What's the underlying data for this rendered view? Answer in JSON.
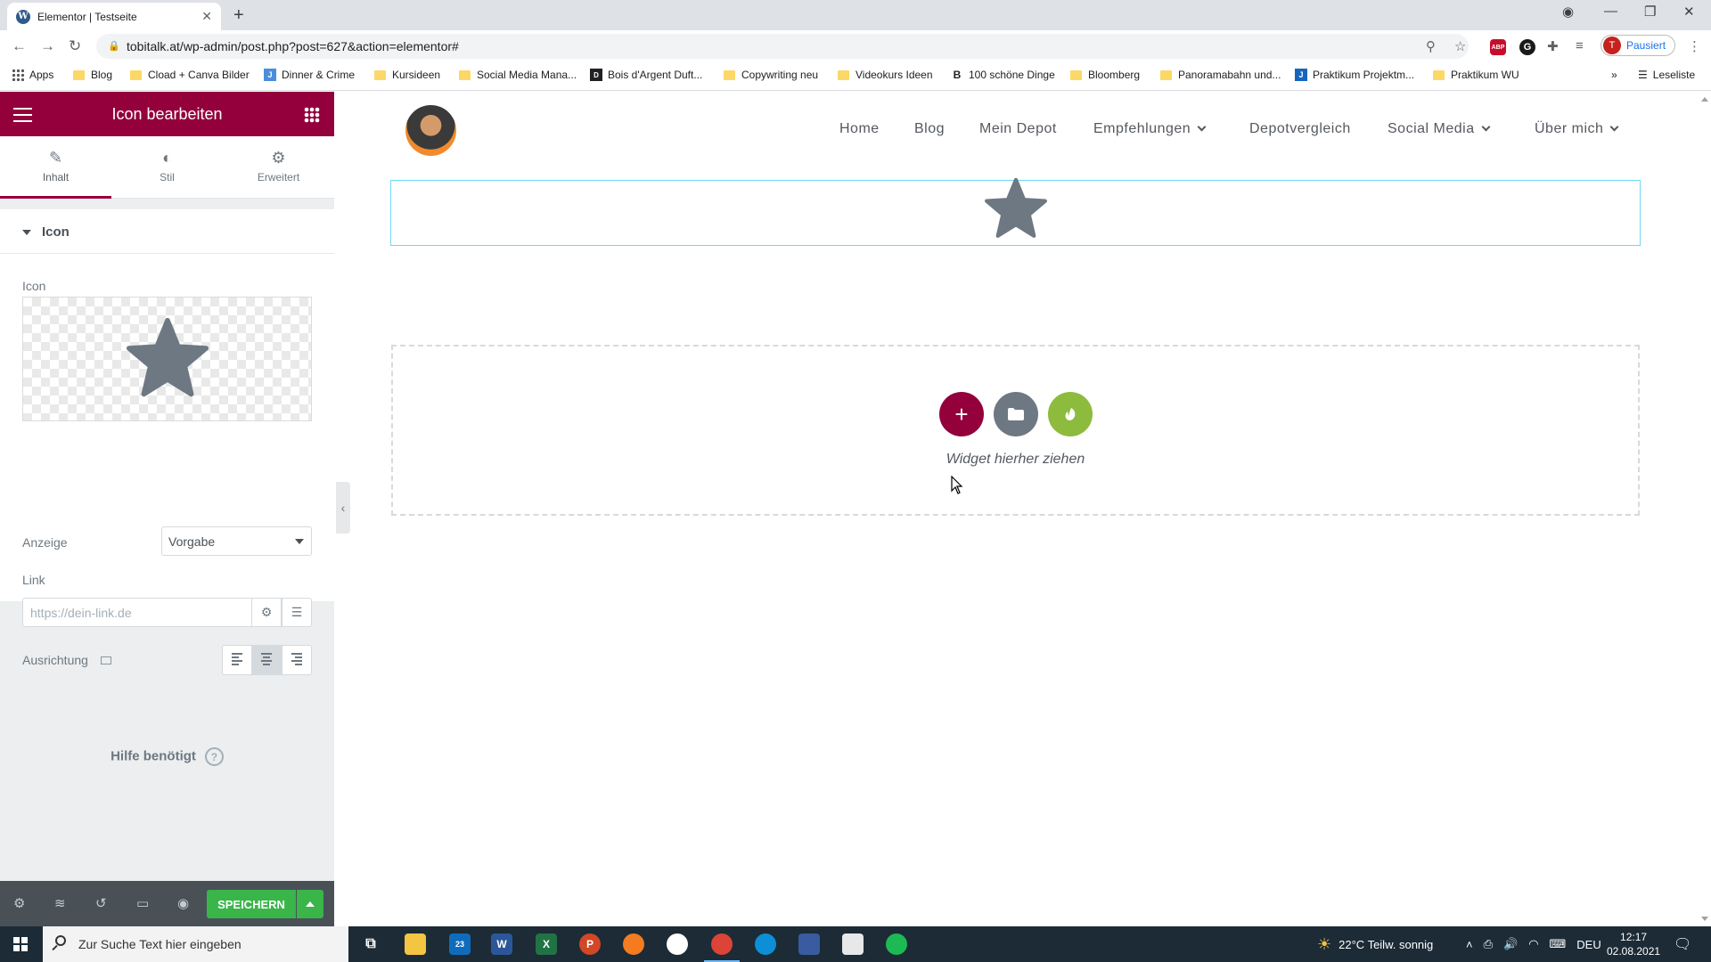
{
  "browser": {
    "tab_title": "Elementor | Testseite",
    "url": "tobitalk.at/wp-admin/post.php?post=627&action=elementor#",
    "profile_initial": "T",
    "profile_status": "Pausiert",
    "reading_list": "Leseliste",
    "abp_label": "ABP",
    "bookmarks": [
      "Apps",
      "Blog",
      "Cload + Canva Bilder",
      "Dinner & Crime",
      "Kursideen",
      "Social Media Mana...",
      "Bois d'Argent Duft...",
      "Copywriting neu",
      "Videokurs Ideen",
      "100 schöne Dinge",
      "Bloomberg",
      "Panoramabahn und...",
      "Praktikum Projektm...",
      "Praktikum WU"
    ]
  },
  "panel": {
    "title": "Icon bearbeiten",
    "tabs": [
      "Inhalt",
      "Stil",
      "Erweitert"
    ],
    "section_title": "Icon",
    "icon_label": "Icon",
    "display_label": "Anzeige",
    "display_value": "Vorgabe",
    "link_label": "Link",
    "link_placeholder": "https://dein-link.de",
    "align_label": "Ausrichtung",
    "help": "Hilfe benötigt",
    "save": "SPEICHERN",
    "accent": "#93003c"
  },
  "preview": {
    "nav": [
      "Home",
      "Blog",
      "Mein Depot",
      "Empfehlungen",
      "Depotvergleich",
      "Social Media",
      "Über mich"
    ],
    "drop_text": "Widget hierher ziehen"
  },
  "taskbar": {
    "search_placeholder": "Zur Suche Text hier eingeben",
    "mail_badge": "23",
    "weather": "22°C  Teilw. sonnig",
    "language": "DEU",
    "time": "12:17",
    "date": "02.08.2021"
  }
}
